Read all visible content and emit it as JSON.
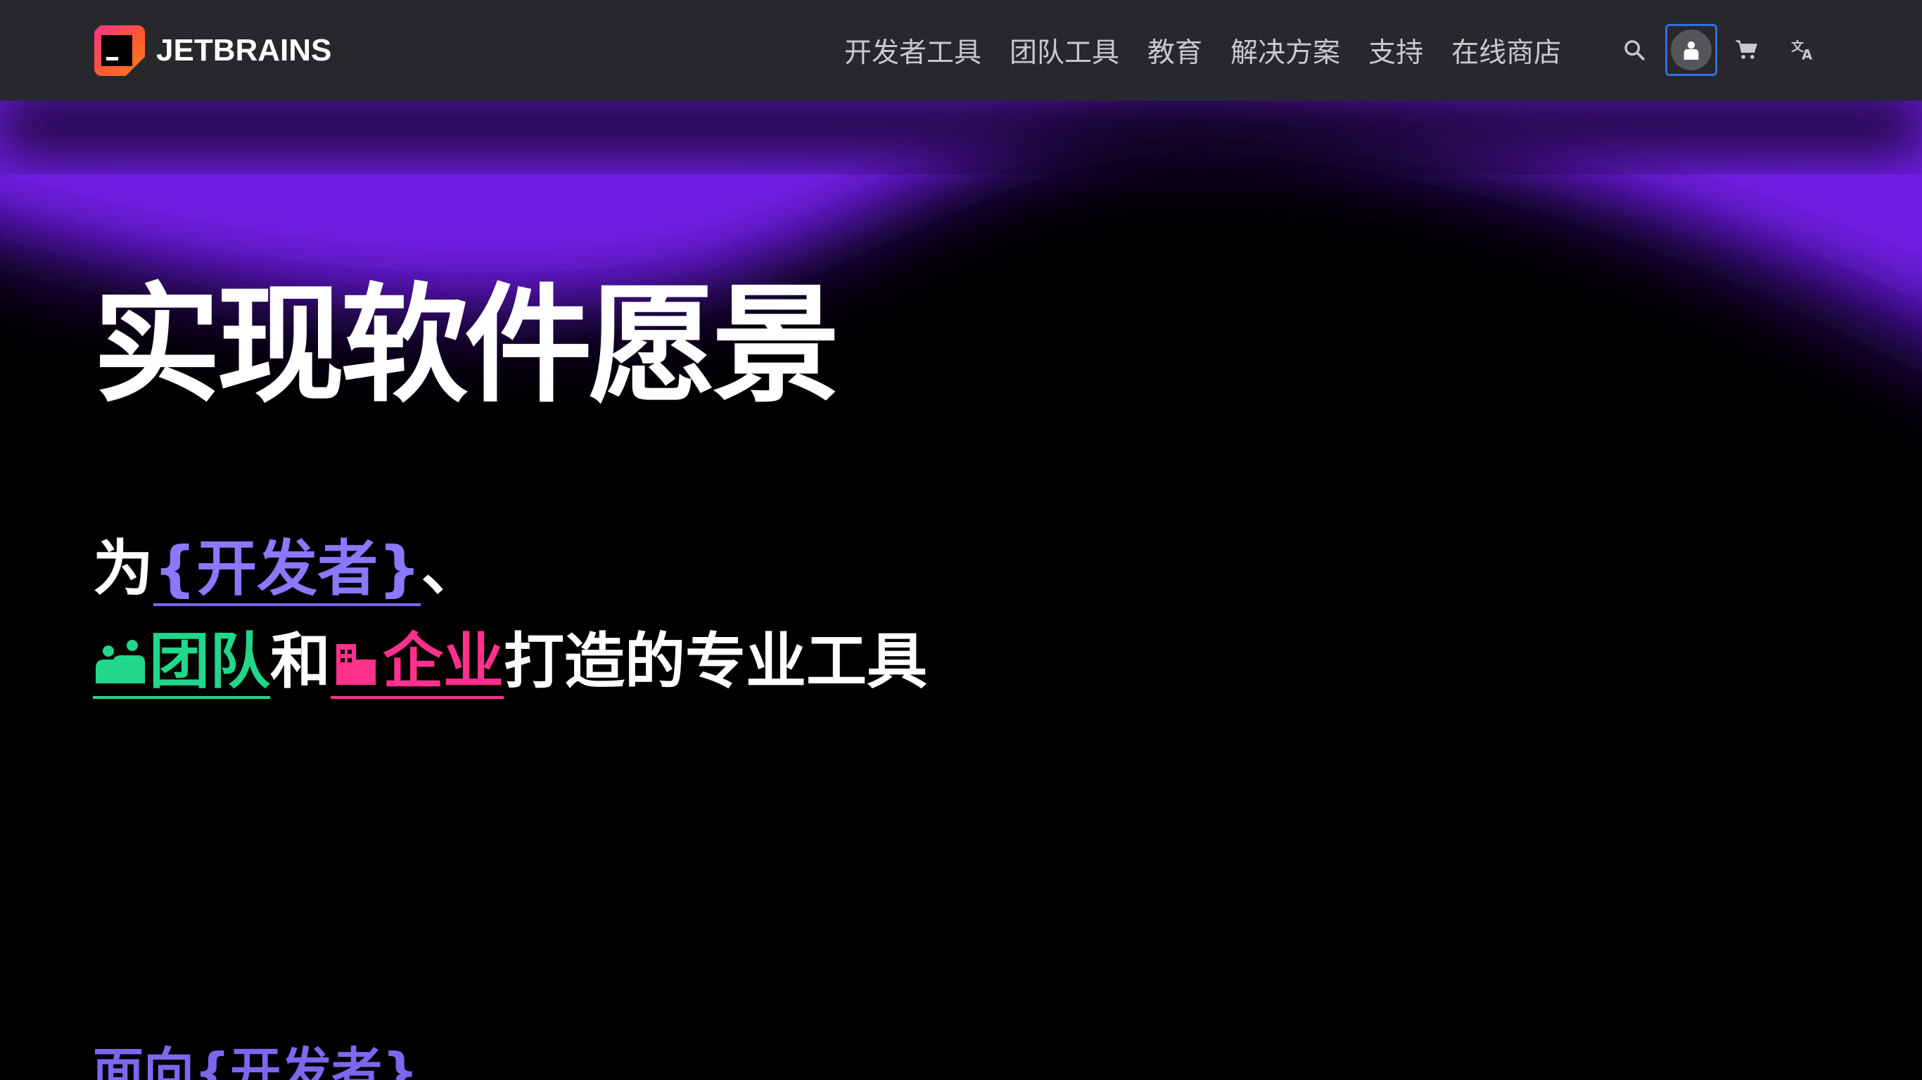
{
  "header": {
    "brand": "JETBRAINS",
    "nav": [
      "开发者工具",
      "团队工具",
      "教育",
      "解决方案",
      "支持",
      "在线商店"
    ],
    "icons": {
      "search": "search-icon",
      "user": "user-icon",
      "cart": "cart-icon",
      "language": "translate-icon"
    }
  },
  "hero": {
    "title": "实现软件愿景",
    "line1": {
      "prefix": "为",
      "developers_link": "{开发者}",
      "separator": "、"
    },
    "line2": {
      "teams_link": "团队",
      "and": "和",
      "enterprise_link": "企业",
      "suffix": "打造的专业工具"
    }
  },
  "next_section": {
    "heading": "面向{开发者}"
  },
  "colors": {
    "header_bg": "#27282c",
    "page_bg": "#000000",
    "developer_accent": "#7b68ee",
    "team_accent": "#21d789",
    "enterprise_accent": "#ff318c",
    "glow": "#6b1de8",
    "focus_ring": "#2f6fe4"
  }
}
